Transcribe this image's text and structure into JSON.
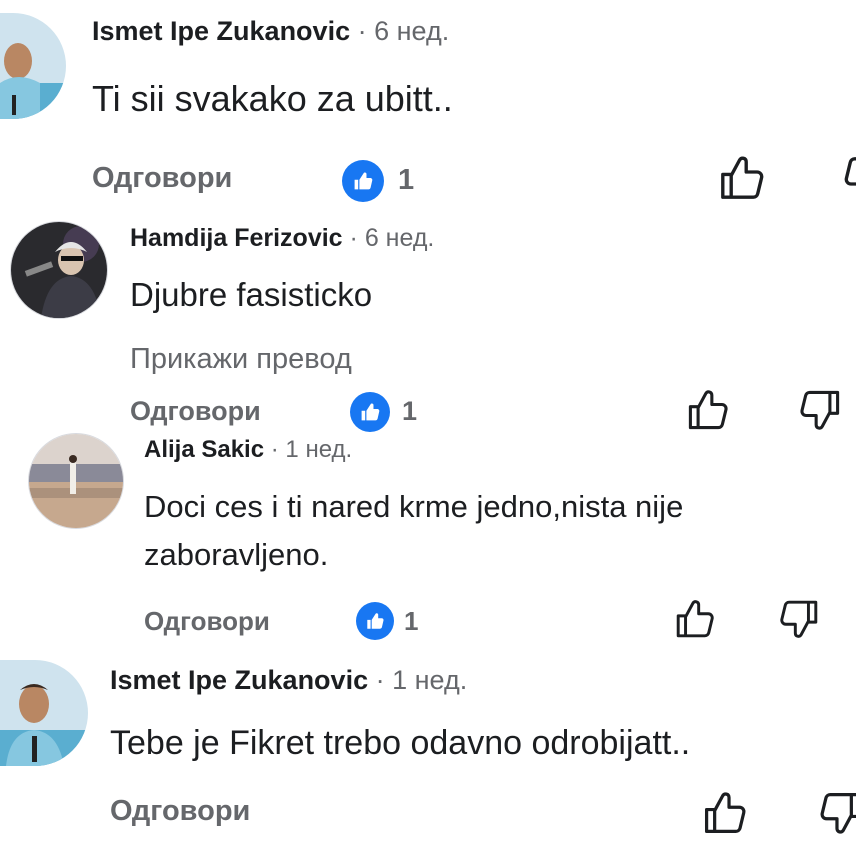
{
  "comments": [
    {
      "author": "Ismet Ipe Zukanovic",
      "dot": "·",
      "time": "6 нед.",
      "text": "Ti sii svakako za ubitt..",
      "reply": "Одговори",
      "likes": "1"
    },
    {
      "author": "Hamdija Ferizovic",
      "dot": "·",
      "time": "6 нед.",
      "text": "Djubre fasisticko",
      "translate": "Прикажи превод",
      "reply": "Одговори",
      "likes": "1"
    },
    {
      "author": "Alija Sakic",
      "dot": "·",
      "time": "1 нед.",
      "text_line1": "Doci ces i ti nared krme jedno,nista nije",
      "text_line2": "zaboravljeno.",
      "reply": "Одговори",
      "likes": "1"
    },
    {
      "author": "Ismet Ipe Zukanovic",
      "dot": "·",
      "time": "1 нед.",
      "text": "Tebe je Fikret trebo odavno odrobijatt..",
      "reply": "Одговори"
    }
  ],
  "colors": {
    "like_blue": "#1877f2",
    "secondary_text": "#65676b",
    "primary_text": "#1c1e21"
  },
  "icons": {
    "like_badge": "thumbs-up-icon",
    "like_action": "thumbs-up-outline-icon",
    "dislike_action": "thumbs-down-outline-icon"
  }
}
